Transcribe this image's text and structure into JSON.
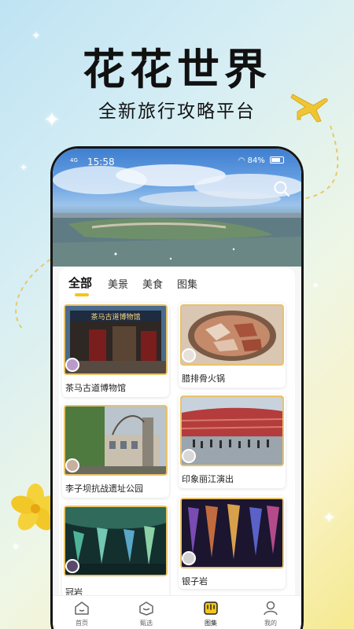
{
  "promo": {
    "title": "花花世界",
    "subtitle": "全新旅行攻略平台"
  },
  "status_bar": {
    "network": "4G",
    "time": "15:58",
    "battery": "84%"
  },
  "tabs": [
    {
      "label": "全部",
      "active": true
    },
    {
      "label": "美景",
      "active": false
    },
    {
      "label": "美食",
      "active": false
    },
    {
      "label": "图集",
      "active": false
    }
  ],
  "cards": [
    {
      "label": "茶马古道博物馆",
      "sign_text": "茶马古道博物馆"
    },
    {
      "label": "腊排骨火锅"
    },
    {
      "label": "李子坝抗战遗址公园"
    },
    {
      "label": "印象丽江演出"
    },
    {
      "label": "冠岩"
    },
    {
      "label": "银子岩"
    }
  ],
  "bottom_nav": [
    {
      "label": "首页",
      "icon": "home-icon",
      "active": false
    },
    {
      "label": "甄选",
      "icon": "select-icon",
      "active": false
    },
    {
      "label": "图集",
      "icon": "gallery-icon",
      "active": true
    },
    {
      "label": "我的",
      "icon": "profile-icon",
      "active": false
    }
  ],
  "colors": {
    "accent": "#f5c518",
    "card_border": "#e9c36a"
  }
}
